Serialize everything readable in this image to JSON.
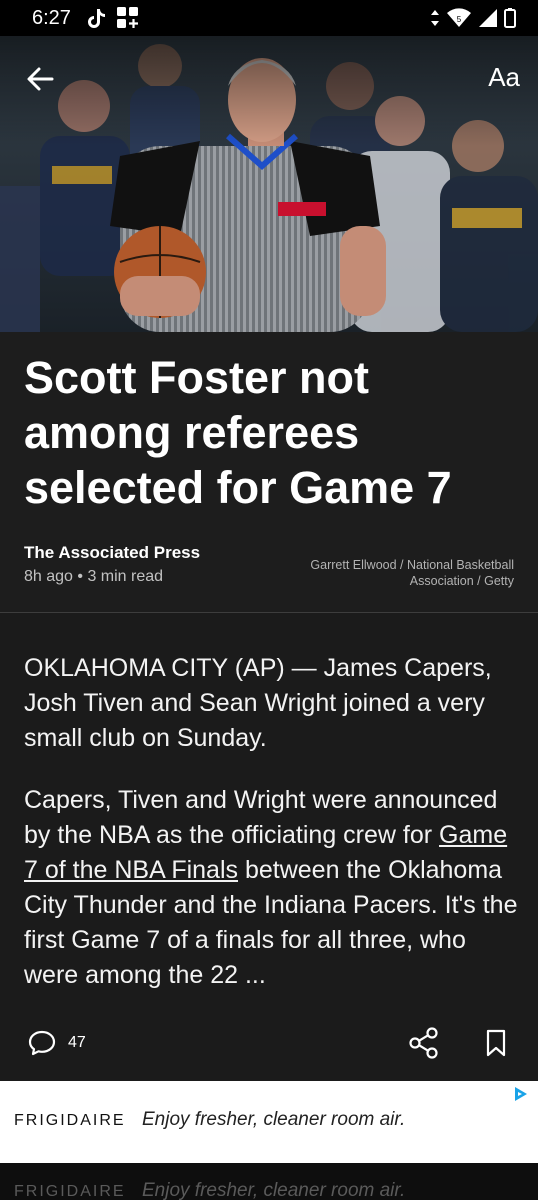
{
  "status_bar": {
    "time": "6:27",
    "left_icons": [
      "tiktok-icon",
      "grid-add-icon"
    ],
    "right_icons": [
      "data-arrows-icon",
      "wifi-icon",
      "signal-icon",
      "battery-icon"
    ],
    "network": "5"
  },
  "toolbar": {
    "back_icon": "arrow-left-icon",
    "font_size_label": "Aa"
  },
  "article": {
    "headline": "Scott Foster not among referees selected for Game 7",
    "source": "The Associated Press",
    "time_ago": "8h ago",
    "read_time": "3 min read",
    "separator": "•",
    "image_credit": "Garrett Ellwood / National Basketball Association / Getty"
  },
  "body": {
    "p1": "OKLAHOMA CITY (AP) — James Capers, Josh Tiven and Sean Wright joined a very small club on Sunday.",
    "p2_before": "Capers, Tiven and Wright were announced by the NBA as the officiating crew for ",
    "p2_link": "Game 7 of the NBA Finals",
    "p2_after": " between the Oklahoma City Thunder and the Indiana Pacers. It's the first Game 7 of a finals for all three, who were among the 22 ..."
  },
  "actions": {
    "comment_count": "47",
    "icons": [
      "comment-icon",
      "share-icon",
      "bookmark-icon"
    ]
  },
  "ad": {
    "brand": "FRIGIDAIRE",
    "text": "Enjoy fresher, cleaner room air.",
    "icon": "adchoices-icon"
  },
  "colors": {
    "background": "#1b1b1b",
    "header_background": "#1d1d1d",
    "text": "#ffffff",
    "muted_text": "#c2c2c2",
    "ad_background": "#ffffff",
    "adchoices": "#1aa3e8"
  }
}
